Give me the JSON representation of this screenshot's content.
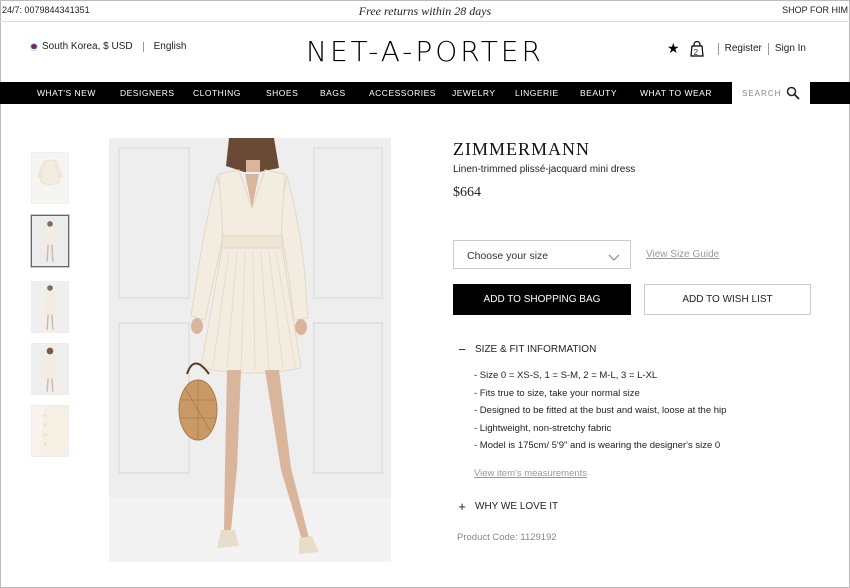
{
  "top_strip": {
    "phone": "24/7: 0079844341351",
    "promo": "Free returns within 28 days",
    "shop_for_him": "SHOP FOR HIM"
  },
  "header": {
    "locale": "South Korea, $ USD",
    "language": "English",
    "logo": "NET-A-PORTER",
    "bag_count": "2",
    "register": "Register",
    "sign_in": "Sign In"
  },
  "nav": {
    "items": [
      "WHAT'S NEW",
      "DESIGNERS",
      "CLOTHING",
      "SHOES",
      "BAGS",
      "ACCESSORIES",
      "JEWELRY",
      "LINGERIE",
      "BEAUTY",
      "WHAT TO WEAR"
    ],
    "search_label": "SEARCH"
  },
  "product": {
    "brand": "ZIMMERMANN",
    "name": "Linen-trimmed plissé-jacquard mini dress",
    "price": "$664",
    "size_select": "Choose your size",
    "size_guide": "View Size Guide",
    "add_to_bag": "ADD TO SHOPPING BAG",
    "add_to_wishlist": "ADD TO WISH LIST",
    "size_fit": {
      "toggle": "−",
      "title": "SIZE & FIT INFORMATION",
      "bullets": [
        "- Size 0 = XS-S, 1 = S-M, 2 = M-L, 3 = L-XL",
        "- Fits true to size, take your normal size",
        "- Designed to be fitted at the bust and waist, loose at the hip",
        "- Lightweight, non-stretchy fabric",
        "- Model is 175cm/ 5'9\" and is wearing the designer's size 0"
      ],
      "measurements_link": "View item's measurements"
    },
    "why_we_love_it": {
      "toggle": "+",
      "title": "WHY WE LOVE IT"
    },
    "product_code": "Product Code: 1129192"
  },
  "colors": {
    "nav_bg": "#000000",
    "dress": "#f3ece0",
    "image_bg": "#eeeeee"
  }
}
